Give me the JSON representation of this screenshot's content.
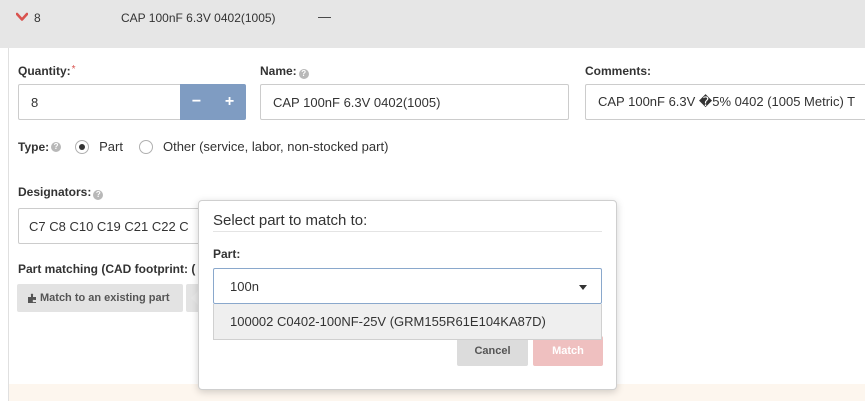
{
  "row": {
    "quantity": "8",
    "name": "CAP 100nF 6.3V 0402(1005)",
    "dash": "—"
  },
  "form": {
    "quantity_label": "Quantity:",
    "required_mark": "*",
    "quantity_value": "8",
    "stepper_minus": "−",
    "stepper_plus": "+",
    "name_label": "Name:",
    "name_value": "CAP 100nF 6.3V 0402(1005)",
    "comments_label": "Comments:",
    "comments_value": "CAP 100nF 6.3V �5% 0402 (1005 Metric) T",
    "type_label": "Type:",
    "type_part": "Part",
    "type_other": "Other (service, labor, non-stocked part)",
    "type_selected": "Part",
    "designators_label": "Designators:",
    "designators_value": "C7 C8 C10 C19 C21 C22 C",
    "part_matching_label": "Part matching (CAD footprint: (",
    "match_existing_button": "Match to an existing part"
  },
  "dialog": {
    "title": "Select part to match to:",
    "part_label": "Part:",
    "search_value": "100n",
    "options": [
      "100002 C0402-100NF-25V (GRM155R61E104KA87D)"
    ],
    "cancel_label": "Cancel",
    "match_label": "Match"
  },
  "colors": {
    "header_bg": "#e6e6e6",
    "stepper": "#7f9cc2",
    "chevron": "#d9534f",
    "match_button": "#efc0c0",
    "notice_bg": "#fdf6ee"
  }
}
